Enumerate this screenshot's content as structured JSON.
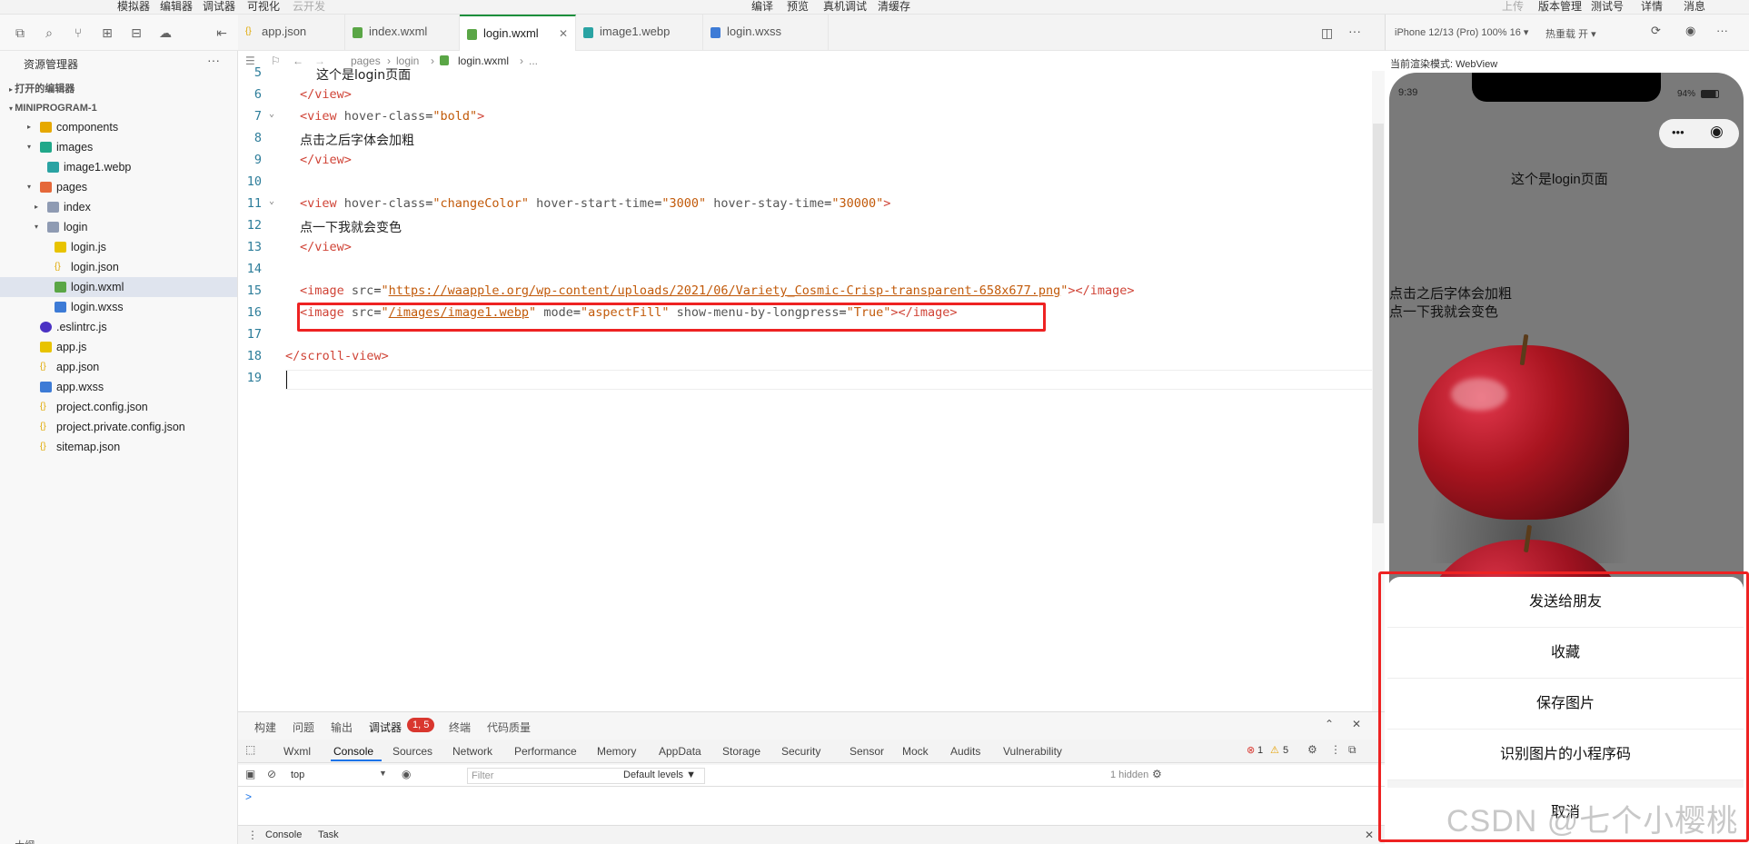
{
  "menubar": {
    "items": [
      "模拟器",
      "编辑器",
      "调试器",
      "可视化",
      "云开发"
    ],
    "center": [
      "编译",
      "预览",
      "真机调试",
      "清缓存"
    ],
    "right": [
      "上传",
      "版本管理",
      "测试号",
      "详情",
      "消息"
    ]
  },
  "sidebar": {
    "title": "资源管理器",
    "more": "···",
    "open_editors": "打开的编辑器",
    "project": "MINIPROGRAM-1",
    "tree": [
      {
        "label": "components",
        "type": "folder"
      },
      {
        "label": "images",
        "type": "folder"
      },
      {
        "label": "image1.webp",
        "type": "image"
      },
      {
        "label": "pages",
        "type": "folder"
      },
      {
        "label": "index",
        "type": "folder"
      },
      {
        "label": "login",
        "type": "folder"
      },
      {
        "label": "login.js",
        "type": "js"
      },
      {
        "label": "login.json",
        "type": "json"
      },
      {
        "label": "login.wxml",
        "type": "wxml"
      },
      {
        "label": "login.wxss",
        "type": "wxss"
      },
      {
        "label": ".eslintrc.js",
        "type": "eslint"
      },
      {
        "label": "app.js",
        "type": "js"
      },
      {
        "label": "app.json",
        "type": "json"
      },
      {
        "label": "app.wxss",
        "type": "wxss"
      },
      {
        "label": "project.config.json",
        "type": "json"
      },
      {
        "label": "project.private.config.json",
        "type": "json"
      },
      {
        "label": "sitemap.json",
        "type": "json"
      }
    ],
    "outline": "大纲"
  },
  "tabs": [
    {
      "label": "app.json",
      "type": "json"
    },
    {
      "label": "index.wxml",
      "type": "wxml"
    },
    {
      "label": "login.wxml",
      "type": "wxml",
      "close": "✕"
    },
    {
      "label": "image1.webp",
      "type": "image"
    },
    {
      "label": "login.wxss",
      "type": "wxss"
    }
  ],
  "breadcrumb": {
    "p1": "pages",
    "p2": "login",
    "p3": "login.wxml",
    "p4": "..."
  },
  "editor": {
    "lines": {
      "n5": "5",
      "n6": "6",
      "n7": "7",
      "n8": "8",
      "n9": "9",
      "n10": "10",
      "n11": "11",
      "n12": "12",
      "n13": "13",
      "n14": "14",
      "n15": "15",
      "n16": "16",
      "n17": "17",
      "n18": "18",
      "n19": "19"
    },
    "l5_text": "这个是login页面",
    "view_close": "</view>",
    "l7_open": "<view",
    "attr_hover_class": "hover-class",
    "l7_value": "\"bold\"",
    "tag_end": ">",
    "l8_text": "点击之后字体会加粗",
    "l11_value": "\"changeColor\"",
    "attr_hover_start": "hover-start-time",
    "l11_start_value": "\"3000\"",
    "attr_hover_stay": "hover-stay-time",
    "l11_stay_value": "\"30000\"",
    "l12_text": "点一下我就会变色",
    "image_open": "<image",
    "attr_src": "src",
    "l15_url": "https://waapple.org/wp-content/uploads/2021/06/Variety_Cosmic-Crisp-transparent-658x677.png",
    "image_close": "></image>",
    "l16_src": "/images/image1.webp",
    "attr_mode": "mode",
    "l16_mode": "\"aspectFill\"",
    "attr_longpress": "show-menu-by-longpress",
    "l16_longpress": "\"True\"",
    "scroll_close": "</scroll-view>",
    "eq": "=",
    "quote": "\""
  },
  "panel": {
    "tabs": [
      "构建",
      "问题",
      "输出",
      "调试器",
      "终端",
      "代码质量"
    ],
    "debugger_badge": "1, 5",
    "devtools_tabs": [
      "Wxml",
      "Console",
      "Sources",
      "Network",
      "Performance",
      "Memory",
      "AppData",
      "Storage",
      "Security",
      "Sensor",
      "Mock",
      "Audits",
      "Vulnerability"
    ],
    "errors": "1",
    "warnings": "5",
    "context": "top",
    "filter_placeholder": "Filter",
    "levels": "Default levels ▼",
    "hidden": "1 hidden",
    "prompt": ">",
    "drawer_tabs": [
      "Console",
      "Task"
    ]
  },
  "simulator": {
    "device": "iPhone 12/13 (Pro) 100% 16 ▾",
    "hotreload": "热重载 开 ▾",
    "render_mode": "当前渲染模式: WebView",
    "time": "9:39",
    "battery": "94%",
    "page_title": "这个是login页面",
    "text1": "点击之后字体会加粗",
    "text2": "点一下我就会变色",
    "sheet": [
      "发送给朋友",
      "收藏",
      "保存图片",
      "识别图片的小程序码",
      "取消"
    ]
  },
  "watermark": "CSDN @七个小樱桃",
  "colors": {
    "accent": "#1b8f3c",
    "highlight": "#e22222",
    "tag": "#d04437",
    "string": "#c25a0a",
    "badge": "#d9372f"
  }
}
